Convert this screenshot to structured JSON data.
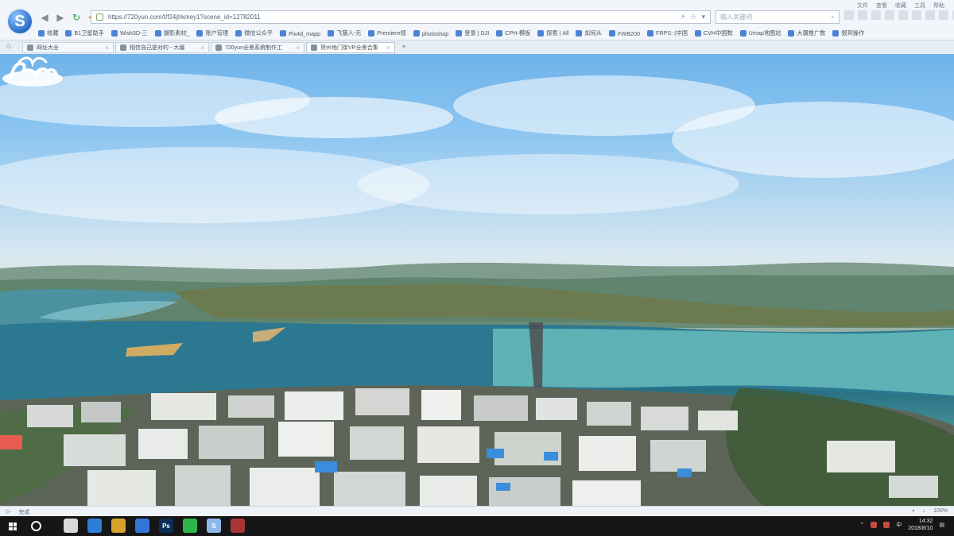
{
  "browser": {
    "url": "https://720yun.com/t/f24jtrkmey1?scene_id=12782011",
    "search_placeholder": "输入关键词",
    "menu": [
      "文件",
      "查看",
      "收藏",
      "工具",
      "帮助"
    ],
    "bookmarks": [
      {
        "label": "收藏"
      },
      {
        "label": "B1卫星助手"
      },
      {
        "label": "Wish3D-三"
      },
      {
        "label": "摄影素材_"
      },
      {
        "label": "账户管理"
      },
      {
        "label": "微信公众平"
      },
      {
        "label": "Pix4d_mapp"
      },
      {
        "label": "飞猫人-无"
      },
      {
        "label": "Premiere视"
      },
      {
        "label": "photoshop"
      },
      {
        "label": "登录 | DJI"
      },
      {
        "label": "CPH-模板"
      },
      {
        "label": "探索 | All"
      },
      {
        "label": "如何从"
      },
      {
        "label": "FWB200"
      },
      {
        "label": "FRPS: (中国"
      },
      {
        "label": "CVH中国数"
      },
      {
        "label": "Umap地图站"
      },
      {
        "label": "大疆推广数"
      },
      {
        "label": "报到操作"
      }
    ],
    "tabs": [
      {
        "label": "网址大全",
        "close": "×"
      },
      {
        "label": "相信自己是对的 - 大疆",
        "close": "×"
      },
      {
        "label": "720yun全景系统制作工",
        "close": "×"
      },
      {
        "label": "贺州地门街VR全景合集",
        "close": "×"
      }
    ],
    "new_tab": "+"
  },
  "status": {
    "left": "完成",
    "zoom": "100%"
  },
  "taskbar": {
    "time": "14:32",
    "date": "2018/8/10",
    "lang": "中"
  }
}
